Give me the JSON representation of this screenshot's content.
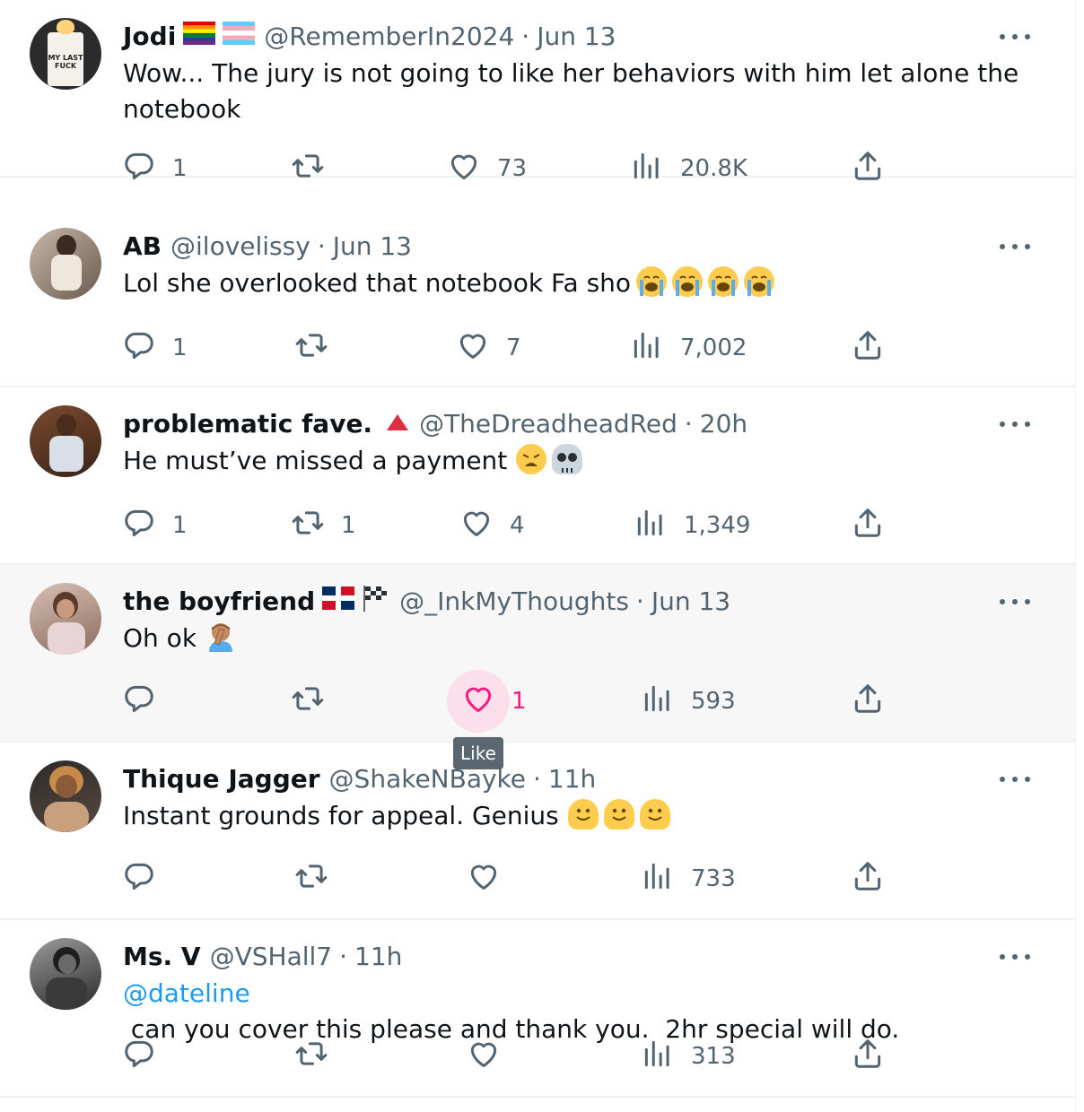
{
  "tweets": [
    {
      "name": "Jodi",
      "handle": "@RememberIn2024",
      "sep": "·",
      "time": "Jun 13",
      "text": "Wow... The jury is not going to like her behaviors with him let alone the notebook",
      "replies": "1",
      "retweets": "",
      "likes": "73",
      "views": "20.8K",
      "avatar_text": "MY LAST FUCK"
    },
    {
      "name": "AB",
      "handle": "@ilovelissy",
      "sep": "·",
      "time": "Jun 13",
      "text": "Lol she overlooked that notebook Fa sho",
      "replies": "1",
      "retweets": "",
      "likes": "7",
      "views": "7,002"
    },
    {
      "name": "problematic fave.",
      "handle": "@TheDreadheadRed",
      "sep": "·",
      "time": "20h",
      "text": "He must’ve missed a payment",
      "replies": "1",
      "retweets": "1",
      "likes": "4",
      "views": "1,349"
    },
    {
      "name": "the boyfriend",
      "handle": "@_InkMyThoughts",
      "sep": "·",
      "time": "Jun 13",
      "text": "Oh ok",
      "replies": "",
      "retweets": "",
      "likes": "1",
      "views": "593",
      "tooltip": "Like"
    },
    {
      "name": "Thique Jagger",
      "handle": "@ShakeNBayke",
      "sep": "·",
      "time": "11h",
      "text": "Instant grounds for appeal. Genius",
      "replies": "",
      "retweets": "",
      "likes": "",
      "views": "733"
    },
    {
      "name": "Ms. V",
      "handle": "@VSHall7",
      "sep": "·",
      "time": "11h",
      "mention": "@dateline",
      "text": " can you cover this please and thank you.  2hr special will do.",
      "replies": "",
      "retweets": "",
      "likes": "",
      "views": "313"
    }
  ],
  "icons": {
    "reply": "reply-icon",
    "retweet": "retweet-icon",
    "like": "heart-icon",
    "views": "views-icon",
    "share": "share-icon",
    "more": "more-icon"
  },
  "colors": {
    "secondary_text": "#536471",
    "link": "#1d9bf0",
    "like_active": "#f91880"
  }
}
